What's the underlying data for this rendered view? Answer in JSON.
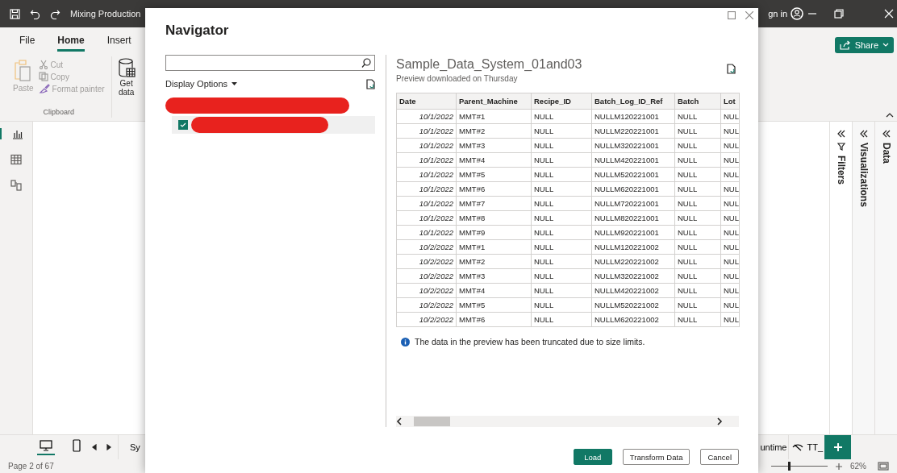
{
  "titlebar": {
    "title": "Mixing Production",
    "sign_in": "gn in"
  },
  "ribbon": {
    "tabs": [
      {
        "label": "File",
        "selected": false
      },
      {
        "label": "Home",
        "selected": true
      },
      {
        "label": "Insert",
        "selected": false
      }
    ],
    "clipboard": {
      "paste": "Paste",
      "cut": "Cut",
      "copy": "Copy",
      "format_painter": "Format painter",
      "group_label": "Clipboard"
    },
    "get_data": "Get data",
    "share": "Share"
  },
  "view_rail": [
    {
      "kind": "report",
      "selected": true
    },
    {
      "kind": "table",
      "selected": false
    },
    {
      "kind": "model",
      "selected": false
    }
  ],
  "panes": [
    {
      "kind": "filters",
      "label": "Filters"
    },
    {
      "kind": "visualizations",
      "label": "Visualizations"
    },
    {
      "kind": "data",
      "label": "Data"
    }
  ],
  "layout_buttons": [
    {
      "kind": "desktop",
      "selected": true
    },
    {
      "kind": "phone",
      "selected": false
    }
  ],
  "page_tabs": [
    {
      "label": "Sy",
      "hidden": false
    },
    {
      "label": "untime",
      "hidden": false
    },
    {
      "label": "TT_",
      "hidden": true
    }
  ],
  "status_bar": {
    "page": "Page 2 of 67",
    "zoom": "62%",
    "level": 0.3
  },
  "navigator": {
    "title": "Navigator",
    "display_options": "Display Options",
    "tree": [
      {
        "redacted": true,
        "children": [
          {
            "redacted": true,
            "checked": true,
            "selected": true
          }
        ]
      }
    ],
    "preview": {
      "title": "Sample_Data_System_01and03",
      "subtitle": "Preview downloaded on Thursday",
      "columns": [
        "Date",
        "Parent_Machine",
        "Recipe_ID",
        "Batch_Log_ID_Ref",
        "Batch",
        "Lot"
      ],
      "rows": [
        [
          "10/1/2022",
          "MMT#1",
          "NULL",
          "NULLM120221001",
          "NULL",
          "NUL"
        ],
        [
          "10/1/2022",
          "MMT#2",
          "NULL",
          "NULLM220221001",
          "NULL",
          "NUL"
        ],
        [
          "10/1/2022",
          "MMT#3",
          "NULL",
          "NULLM320221001",
          "NULL",
          "NUL"
        ],
        [
          "10/1/2022",
          "MMT#4",
          "NULL",
          "NULLM420221001",
          "NULL",
          "NUL"
        ],
        [
          "10/1/2022",
          "MMT#5",
          "NULL",
          "NULLM520221001",
          "NULL",
          "NUL"
        ],
        [
          "10/1/2022",
          "MMT#6",
          "NULL",
          "NULLM620221001",
          "NULL",
          "NUL"
        ],
        [
          "10/1/2022",
          "MMT#7",
          "NULL",
          "NULLM720221001",
          "NULL",
          "NUL"
        ],
        [
          "10/1/2022",
          "MMT#8",
          "NULL",
          "NULLM820221001",
          "NULL",
          "NUL"
        ],
        [
          "10/1/2022",
          "MMT#9",
          "NULL",
          "NULLM920221001",
          "NULL",
          "NUL"
        ],
        [
          "10/2/2022",
          "MMT#1",
          "NULL",
          "NULLM120221002",
          "NULL",
          "NUL"
        ],
        [
          "10/2/2022",
          "MMT#2",
          "NULL",
          "NULLM220221002",
          "NULL",
          "NUL"
        ],
        [
          "10/2/2022",
          "MMT#3",
          "NULL",
          "NULLM320221002",
          "NULL",
          "NUL"
        ],
        [
          "10/2/2022",
          "MMT#4",
          "NULL",
          "NULLM420221002",
          "NULL",
          "NUL"
        ],
        [
          "10/2/2022",
          "MMT#5",
          "NULL",
          "NULLM520221002",
          "NULL",
          "NUL"
        ],
        [
          "10/2/2022",
          "MMT#6",
          "NULL",
          "NULLM620221002",
          "NULL",
          "NUL"
        ]
      ],
      "note": "The data in the preview has been truncated due to size limits."
    },
    "buttons": [
      {
        "kind": "primary",
        "label": "Load"
      },
      {
        "kind": "default",
        "label": "Transform Data"
      },
      {
        "kind": "default",
        "label": "Cancel"
      }
    ]
  }
}
